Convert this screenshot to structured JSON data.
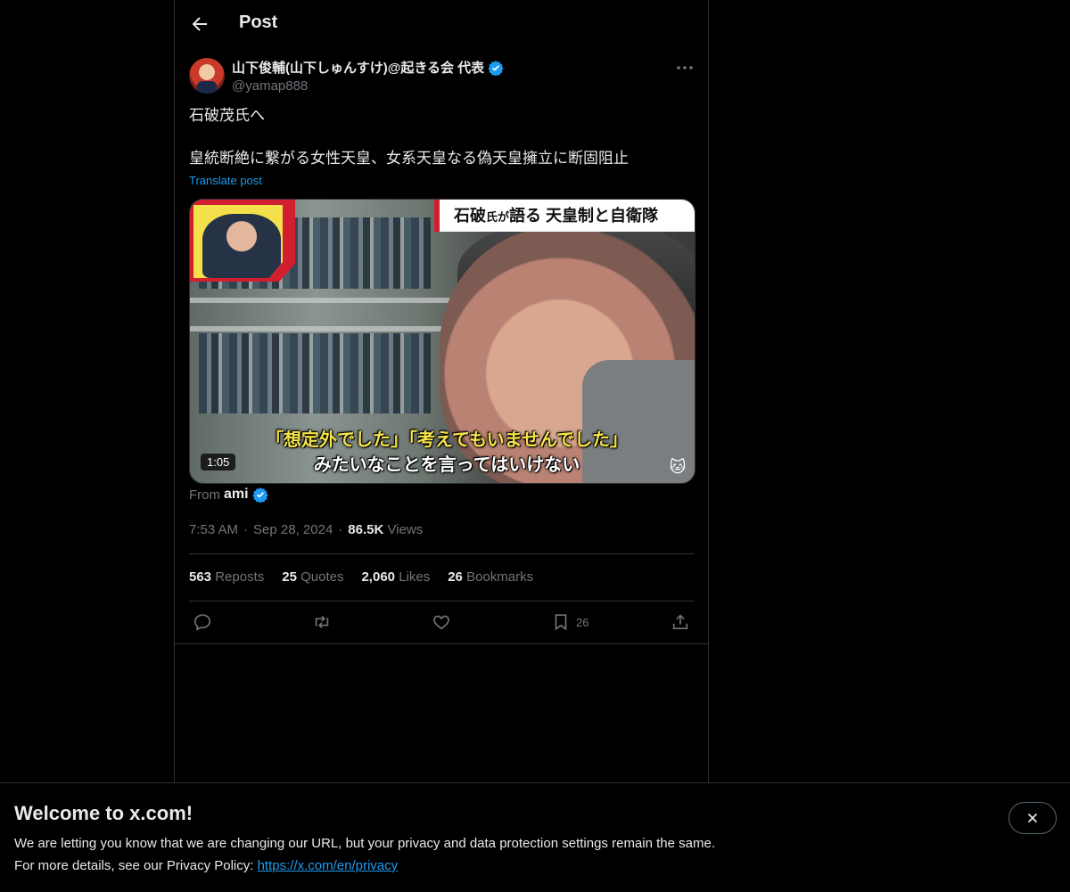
{
  "header": {
    "title": "Post"
  },
  "author": {
    "display_name": "山下俊輔(山下しゅんすけ)@起きる会 代表",
    "handle": "@yamap888",
    "verified": true
  },
  "tweet": {
    "line1": "石破茂氏へ",
    "line2": "皇統断絶に繋がる女性天皇、女系天皇なる偽天皇擁立に断固阻止",
    "translate_label": "Translate post"
  },
  "media": {
    "headline_prefix": "石破",
    "headline_small": "氏が",
    "headline_main": "語る 天皇制と自衛隊",
    "caption_hl": "「想定外でした」「考えてもいませんでした」",
    "caption_line2": "みたいなことを言ってはいけない",
    "duration": "1:05"
  },
  "source": {
    "prefix": "From",
    "name": "ami",
    "verified": true
  },
  "meta": {
    "time": "7:53 AM",
    "date": "Sep 28, 2024",
    "views_count": "86.5K",
    "views_label": "Views"
  },
  "stats": {
    "reposts_count": "563",
    "reposts_label": "Reposts",
    "quotes_count": "25",
    "quotes_label": "Quotes",
    "likes_count": "2,060",
    "likes_label": "Likes",
    "bookmarks_count": "26",
    "bookmarks_label": "Bookmarks"
  },
  "actions": {
    "bookmark_count": "26"
  },
  "banner": {
    "title": "Welcome to x.com!",
    "line1": "We are letting you know that we are changing our URL, but your privacy and data protection settings remain the same.",
    "line2_prefix": "For more details, see our Privacy Policy: ",
    "link": "https://x.com/en/privacy"
  },
  "colors": {
    "accent": "#1d9bf0",
    "background": "#000000",
    "muted": "#71767b",
    "text": "#e7e9ea",
    "border": "#2f3336"
  }
}
